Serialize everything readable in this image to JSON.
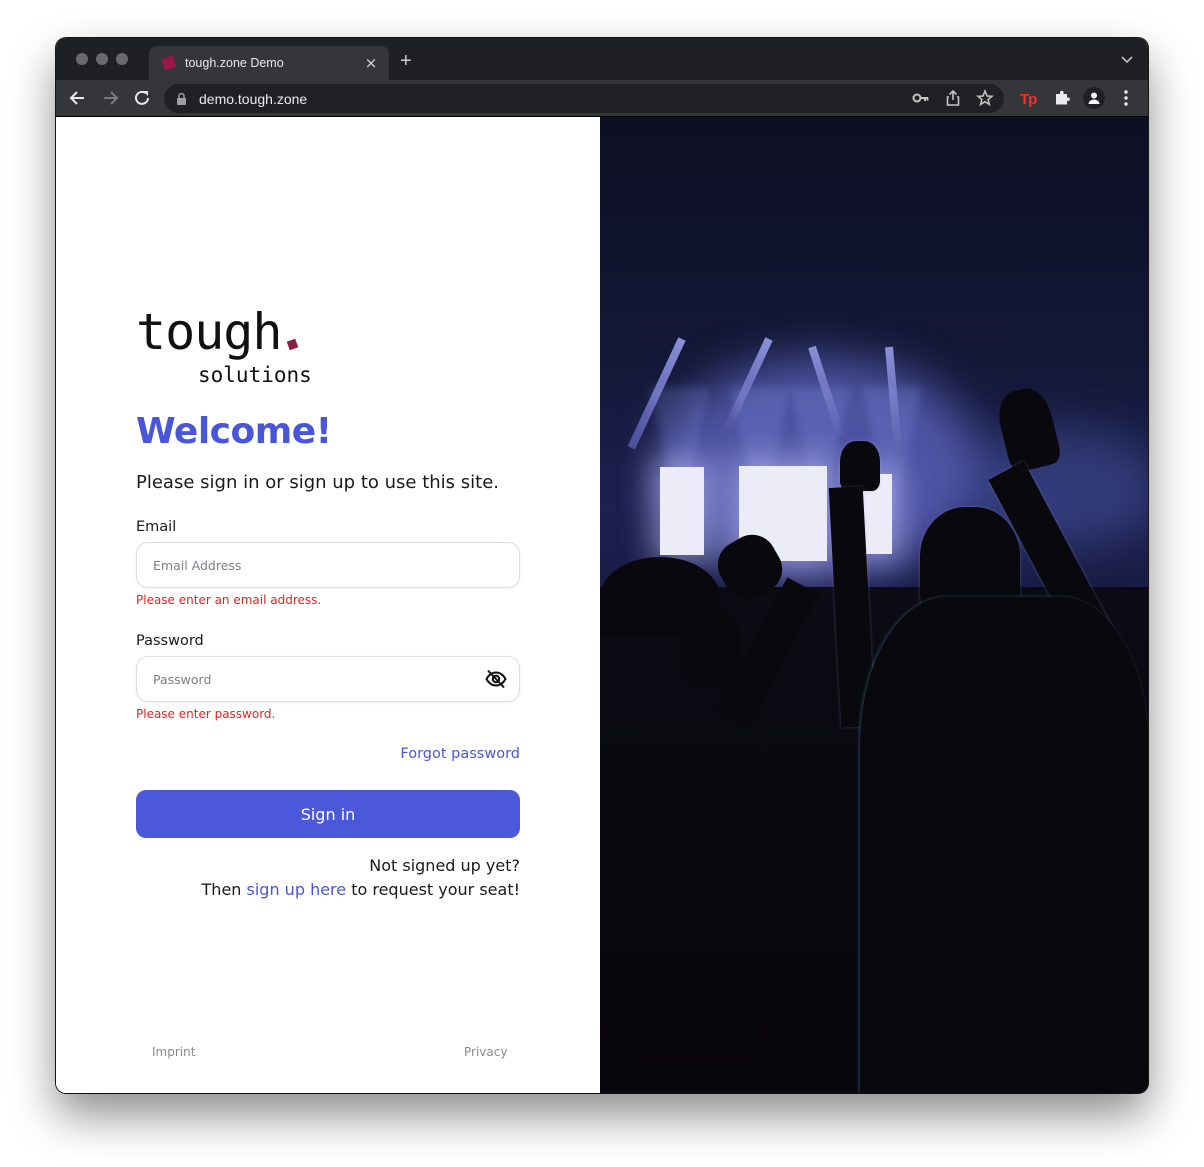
{
  "browser": {
    "tab_title": "tough.zone Demo",
    "tab_close_icon": "×",
    "new_tab_icon": "+",
    "url": "demo.tough.zone",
    "favicon_color": "#9b1746",
    "extension_label": "Tp"
  },
  "logo": {
    "main": "tough",
    "sub": "solutions",
    "dot_color": "#8c1d43"
  },
  "login": {
    "welcome": "Welcome!",
    "subtitle": "Please sign in or sign up to use this site.",
    "email_label": "Email",
    "email_placeholder": "Email Address",
    "email_value": "",
    "email_error": "Please enter an email address.",
    "password_label": "Password",
    "password_placeholder": "Password",
    "password_value": "",
    "password_error": "Please enter password.",
    "forgot_password": "Forgot password",
    "signin_button": "Sign in",
    "signup_line1": "Not signed up yet?",
    "signup_prefix": "Then ",
    "signup_link": "sign up here",
    "signup_suffix": " to request your seat!"
  },
  "footer": {
    "imprint": "Imprint",
    "privacy": "Privacy"
  },
  "colors": {
    "accent": "#4a56d8",
    "button": "#4a58d9",
    "error": "#e02424"
  },
  "hero_image": {
    "description": "concert crowd with raised hands in front of an illuminated stage"
  }
}
